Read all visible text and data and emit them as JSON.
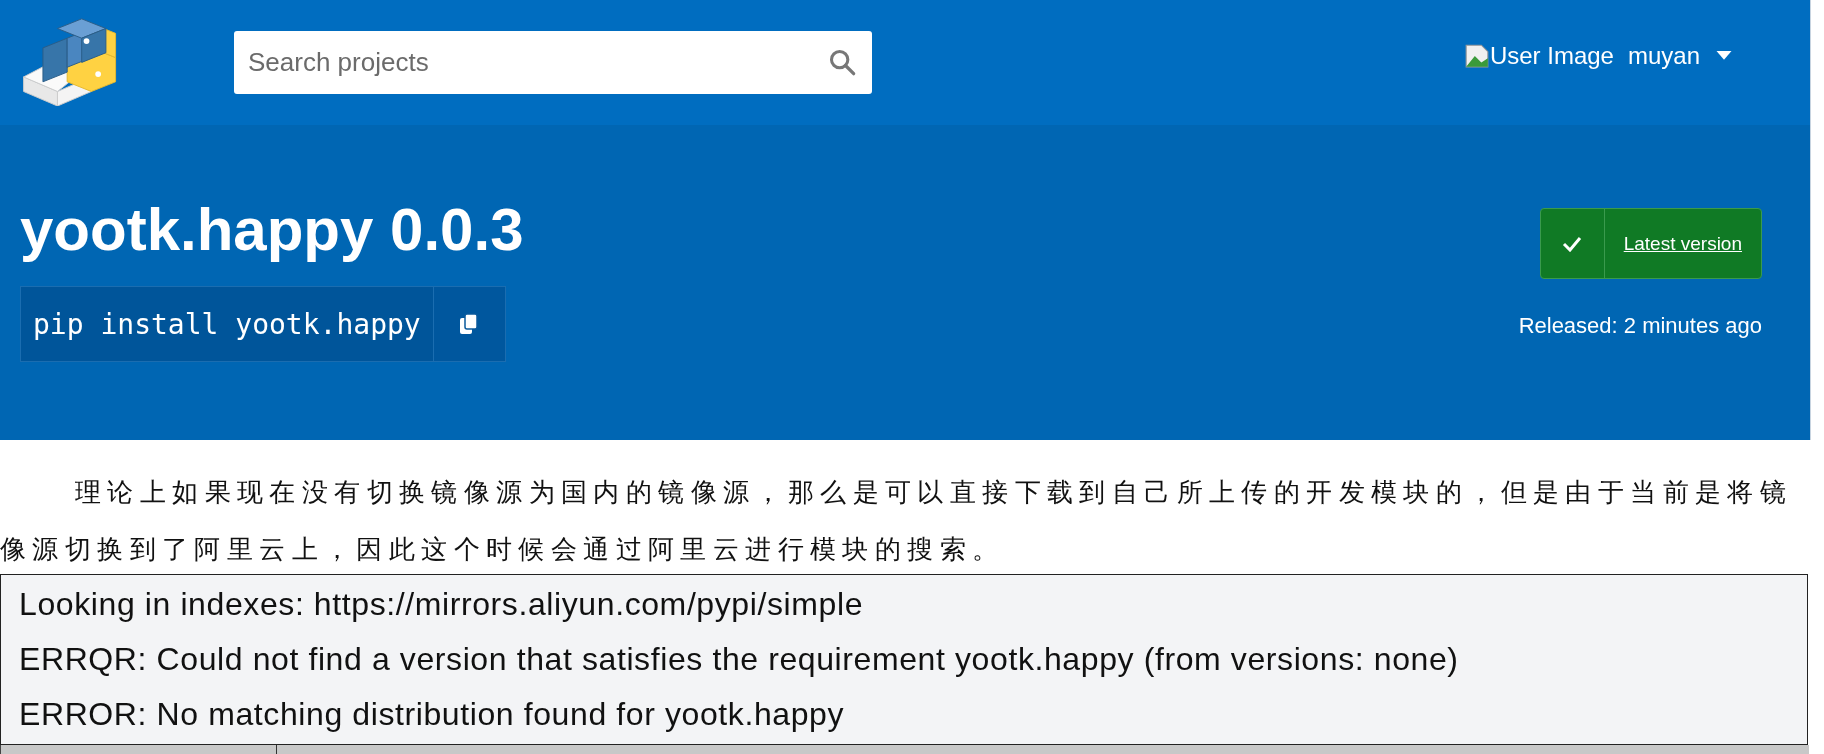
{
  "header": {
    "search": {
      "placeholder": "Search projects"
    },
    "user": {
      "image_alt": "User Image",
      "name": "muyan"
    }
  },
  "package": {
    "title": "yootk.happy 0.0.3",
    "install_command": "pip install yootk.happy",
    "latest_badge": "Latest version",
    "released": "Released: 2 minutes ago"
  },
  "document": {
    "paragraph": "理论上如果现在没有切换镜像源为国内的镜像源，那么是可以直接下载到自己所上传的开发模块的，但是由于当前是将镜像源切换到了阿里云上，因此这个时候会通过阿里云进行模块的搜索。",
    "code_lines": [
      "Looking in indexes: https://mirrors.aliyun.com/pypi/simple",
      "ERRQR: Could not find a version that satisfies the requirement yootk.happy (from versions: none)",
      "ERROR: No matching distribution found for yootk.happy"
    ]
  }
}
